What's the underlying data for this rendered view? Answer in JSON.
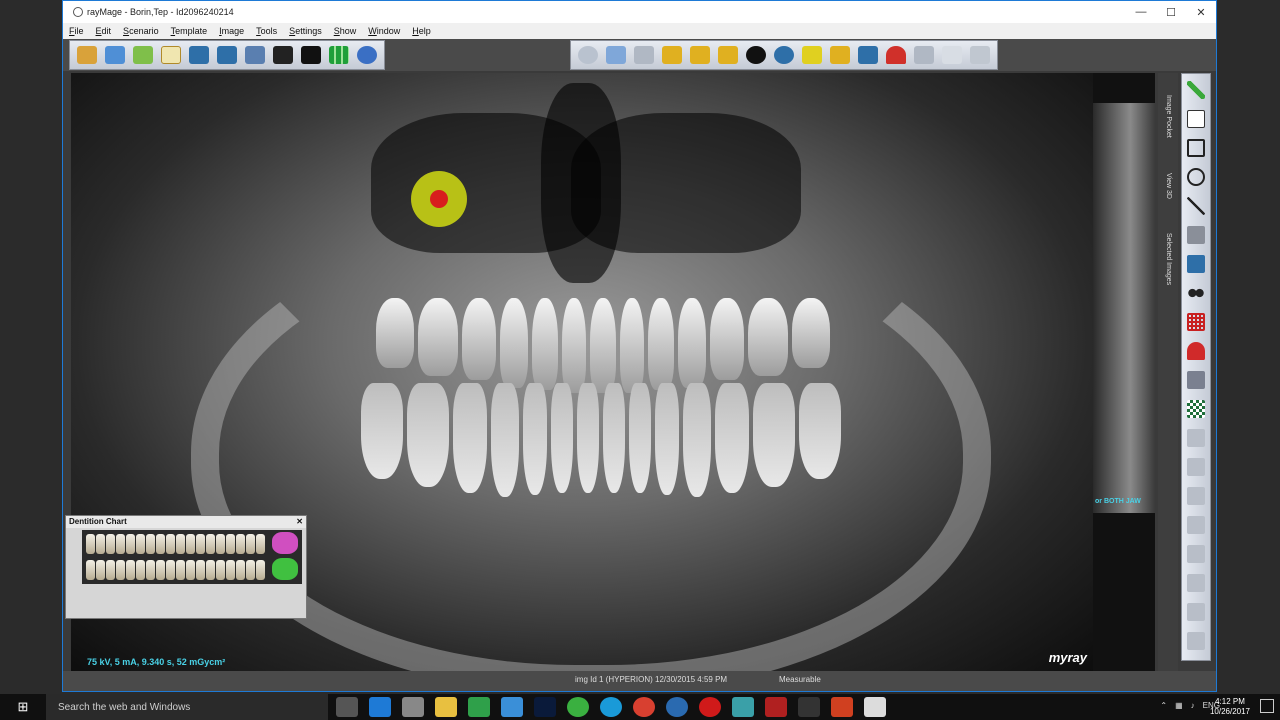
{
  "window": {
    "title": "rayMage - Borin,Tep - Id2096240214",
    "controls": {
      "minimize": "—",
      "maximize": "☐",
      "close": "✕"
    }
  },
  "menu": [
    "File",
    "Edit",
    "Scenario",
    "Template",
    "Image",
    "Tools",
    "Settings",
    "Show",
    "Window",
    "Help"
  ],
  "toolbar_left": [
    "patients-icon",
    "archive-icon",
    "acquire-icon",
    "edit-icon",
    "export-icon",
    "send-icon",
    "tools-icon",
    "monitor-icon",
    "display-icon",
    "layout-grid-icon",
    "help-icon"
  ],
  "toolbar_right": [
    "select-icon",
    "zoom-icon",
    "filter-icon",
    "brightness-icon",
    "contrast-icon",
    "sharpen-icon",
    "invert-icon",
    "measure-icon",
    "add-icon",
    "annotate-icon",
    "implant-icon",
    "heart-icon",
    "rotate-icon",
    "tooth-icon",
    "calibrate-icon"
  ],
  "image": {
    "exposure": "75 kV, 5 mA, 9.340 s, 52 mGycm²",
    "brand": "myray",
    "side_label": "or BOTH JAW"
  },
  "vertical_tabs": [
    "Image Pocket",
    "View 3D",
    "Selected Images"
  ],
  "right_tools": [
    "pencil-icon",
    "text-icon",
    "rectangle-icon",
    "ellipse-icon",
    "line-icon",
    "brush-icon",
    "ruler-icon",
    "eyes-icon",
    "grid-icon",
    "magnet-icon",
    "calibrate-icon",
    "checker-icon",
    "flip-icon",
    "crop-icon",
    "align-icon",
    "layout-icon",
    "bars-icon",
    "stack-icon",
    "columns-icon",
    "chart-icon",
    "target-icon"
  ],
  "dentition_chart": {
    "title": "Dentition Chart",
    "close": "✕"
  },
  "status": {
    "image_info": "img Id 1 (HYPERION) 12/30/2015 4:59 PM",
    "mode": "Measurable"
  },
  "taskbar": {
    "search_placeholder": "Search the web and Windows",
    "language": "ENG",
    "time": "4:12 PM",
    "date": "10/26/2017"
  },
  "colors": {
    "accent": "#1e7ad6",
    "exposure_text": "#49d1e6",
    "cursor_ring": "#c8d214",
    "cursor_dot": "#d81d1d"
  }
}
